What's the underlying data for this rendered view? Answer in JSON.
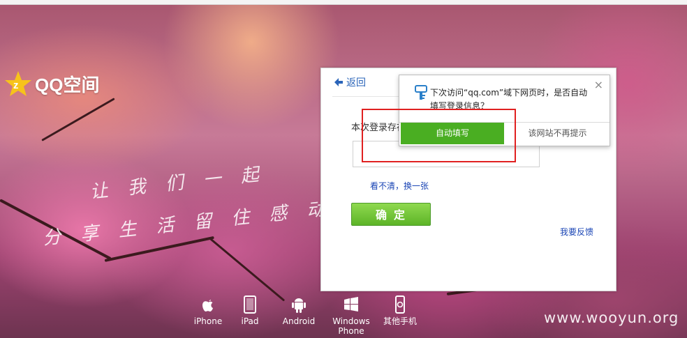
{
  "brand": {
    "name": "QQ空间"
  },
  "slogan": {
    "line1": "让 我 们 一 起",
    "line2": "分 享 生 活 留 住 感 动 !"
  },
  "panel": {
    "back_label": "返回",
    "description": "本次登录存在",
    "verify_input_value": "",
    "refresh_link": "看不清，换一张",
    "confirm_label": "确定",
    "feedback_link": "我要反馈"
  },
  "popup": {
    "message": "下次访问“qq.com”域下网页时，是否自动填写登录信息？",
    "close": "×",
    "autofill_label": "自动填写",
    "never_label": "该网站不再提示"
  },
  "platforms": [
    {
      "label": "iPhone",
      "icon": "apple-icon"
    },
    {
      "label": "iPad",
      "icon": "ipad-icon"
    },
    {
      "label": "Android",
      "icon": "android-icon"
    },
    {
      "label": "Windows Phone",
      "icon": "windows-icon"
    },
    {
      "label": "其他手机",
      "icon": "phone-icon"
    }
  ],
  "watermark": "www.wooyun.org",
  "colors": {
    "accent_green": "#4aae22",
    "link_blue": "#1a45b5",
    "highlight_red": "#e02020"
  }
}
